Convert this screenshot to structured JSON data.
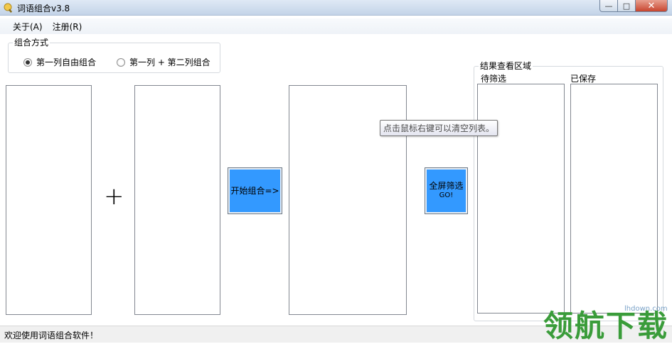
{
  "window": {
    "title": "词语组合v3.8",
    "min_glyph": "—",
    "max_glyph": "□",
    "close_glyph": "✕"
  },
  "menu": [
    {
      "label": "关于(A)"
    },
    {
      "label": "注册(R)"
    }
  ],
  "mode_group": {
    "title": "组合方式",
    "options": [
      {
        "label": "第一列自由组合",
        "checked": true
      },
      {
        "label": "第一列 + 第二列组合",
        "checked": false
      }
    ]
  },
  "plus_sign": "+",
  "buttons": {
    "combine": "开始组合=>",
    "filter_line1": "全屏筛选",
    "filter_line2": "GO!"
  },
  "tooltip": "点击鼠标右键可以清空列表。",
  "results_group": {
    "title": "结果查看区域",
    "pending_label": "待筛选",
    "saved_label": "已保存"
  },
  "status": "欢迎使用词语组合软件！",
  "watermark": {
    "site": "lhdown.com",
    "text": "领航下载"
  },
  "colors": {
    "accent_button": "#3399ff",
    "watermark": "#3a9c3a"
  }
}
